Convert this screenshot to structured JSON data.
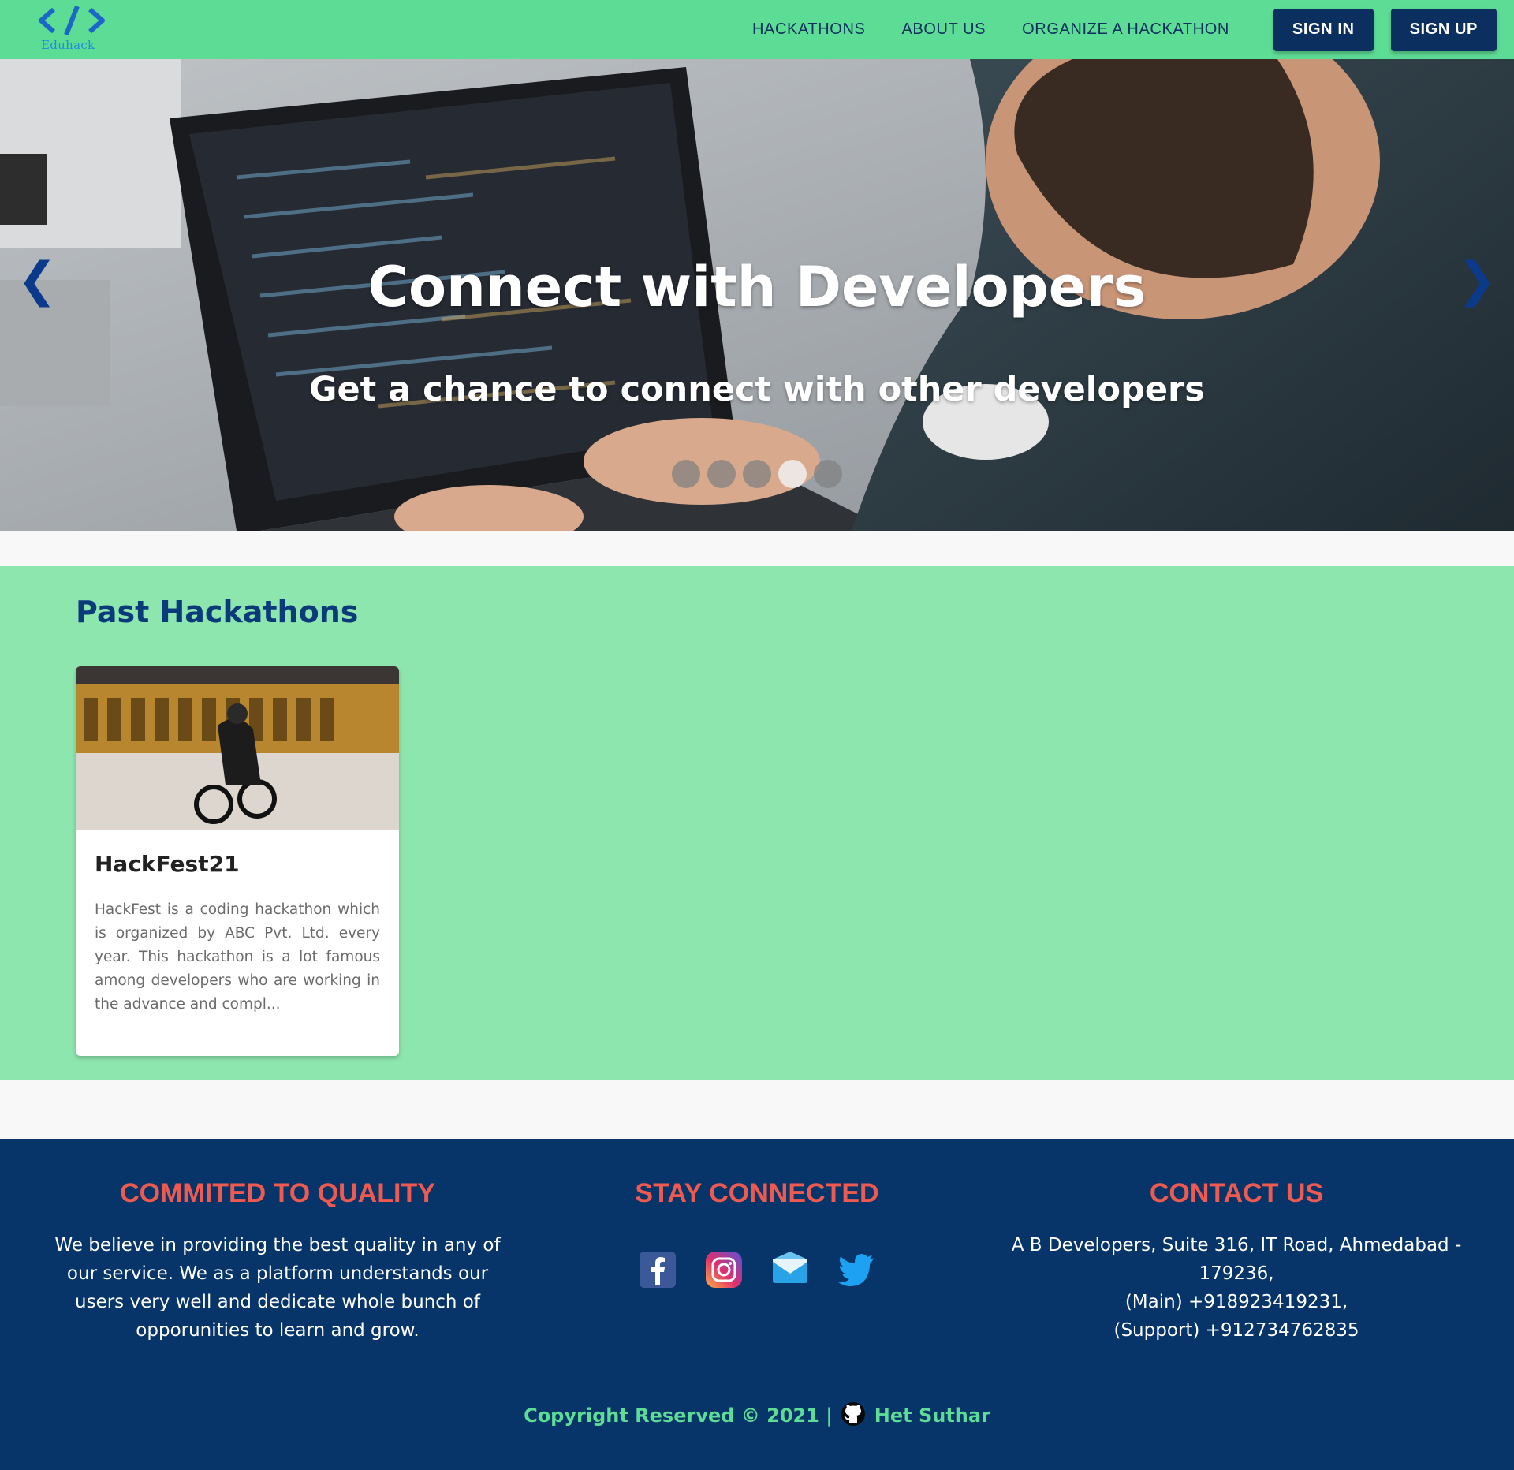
{
  "brand": {
    "name": "Eduhack"
  },
  "nav": {
    "links": [
      "HACKATHONS",
      "ABOUT US",
      "ORGANIZE A HACKATHON"
    ],
    "sign_in": "SIGN IN",
    "sign_up": "SIGN UP"
  },
  "hero": {
    "title": "Connect with Developers",
    "subtitle": "Get a chance to connect with other developers",
    "prev_icon": "chevron-left-icon",
    "next_icon": "chevron-right-icon",
    "slide_count": 5,
    "active_slide": 4
  },
  "past": {
    "title": "Past Hackathons",
    "cards": [
      {
        "title": "HackFest21",
        "description": "HackFest is a coding hackathon which is organized by ABC Pvt. Ltd. every year. This hackathon is a lot famous among developers who are working in the advance and compl..."
      }
    ]
  },
  "footer": {
    "quality": {
      "heading": "COMMITED TO QUALITY",
      "text": "We believe in providing the best quality in any of our service. We as a platform understands our users very well and dedicate whole bunch of opporunities to learn and grow."
    },
    "connected": {
      "heading": "STAY CONNECTED",
      "icons": [
        "facebook-icon",
        "instagram-icon",
        "mail-icon",
        "twitter-icon"
      ]
    },
    "contact": {
      "heading": "CONTACT US",
      "address": "A B Developers, Suite 316, IT Road, Ahmedabad - 179236,",
      "main": "(Main) +918923419231,",
      "support": "(Support) +912734762835"
    },
    "copyright": "Copyright Reserved © 2021 |",
    "author": "Het Suthar"
  },
  "colors": {
    "navbar": "#5ddc95",
    "navy": "#0b2f5e",
    "section_bg": "#8ee6af",
    "footer_bg": "#073569",
    "footer_heading": "#ef5a50",
    "copyright": "#5ddc95"
  }
}
